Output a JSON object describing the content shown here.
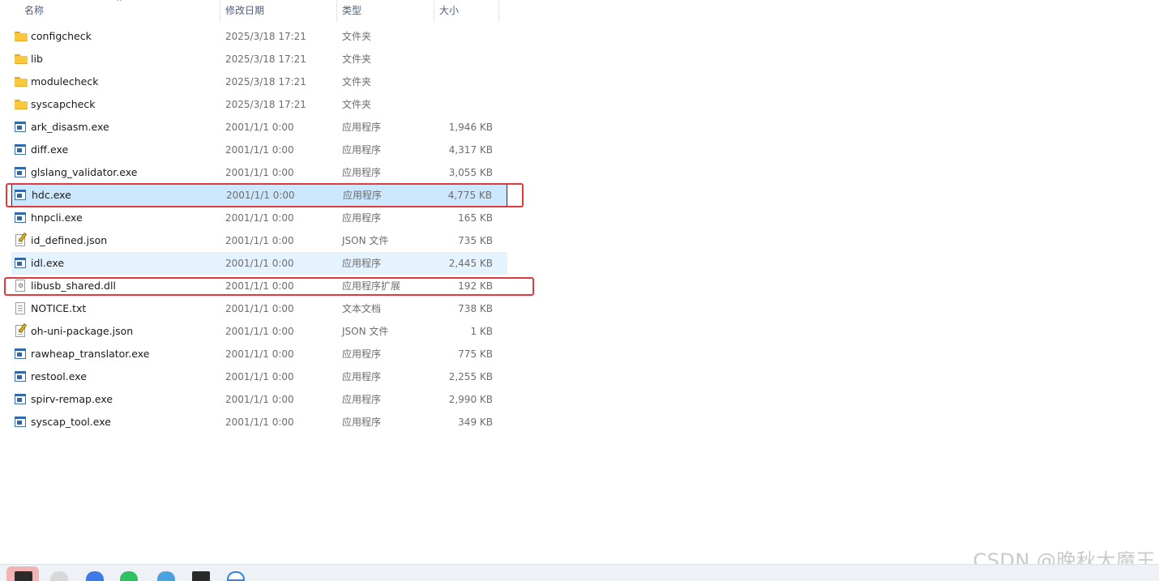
{
  "columns": {
    "name": "名称",
    "date": "修改日期",
    "type": "类型",
    "size": "大小"
  },
  "sort_indicator": "^",
  "files": [
    {
      "name": "configcheck",
      "date": "2025/3/18 17:21",
      "type": "文件夹",
      "size": "",
      "icon": "folder-icon"
    },
    {
      "name": "lib",
      "date": "2025/3/18 17:21",
      "type": "文件夹",
      "size": "",
      "icon": "folder-icon"
    },
    {
      "name": "modulecheck",
      "date": "2025/3/18 17:21",
      "type": "文件夹",
      "size": "",
      "icon": "folder-icon"
    },
    {
      "name": "syscapcheck",
      "date": "2025/3/18 17:21",
      "type": "文件夹",
      "size": "",
      "icon": "folder-icon"
    },
    {
      "name": "ark_disasm.exe",
      "date": "2001/1/1 0:00",
      "type": "应用程序",
      "size": "1,946 KB",
      "icon": "exe-icon"
    },
    {
      "name": "diff.exe",
      "date": "2001/1/1 0:00",
      "type": "应用程序",
      "size": "4,317 KB",
      "icon": "exe-icon"
    },
    {
      "name": "glslang_validator.exe",
      "date": "2001/1/1 0:00",
      "type": "应用程序",
      "size": "3,055 KB",
      "icon": "exe-icon"
    },
    {
      "name": "hdc.exe",
      "date": "2001/1/1 0:00",
      "type": "应用程序",
      "size": "4,775 KB",
      "icon": "exe-icon"
    },
    {
      "name": "hnpcli.exe",
      "date": "2001/1/1 0:00",
      "type": "应用程序",
      "size": "165 KB",
      "icon": "exe-icon"
    },
    {
      "name": "id_defined.json",
      "date": "2001/1/1 0:00",
      "type": "JSON 文件",
      "size": "735 KB",
      "icon": "json-file-icon"
    },
    {
      "name": "idl.exe",
      "date": "2001/1/1 0:00",
      "type": "应用程序",
      "size": "2,445 KB",
      "icon": "exe-icon"
    },
    {
      "name": "libusb_shared.dll",
      "date": "2001/1/1 0:00",
      "type": "应用程序扩展",
      "size": "192 KB",
      "icon": "dll-file-icon"
    },
    {
      "name": "NOTICE.txt",
      "date": "2001/1/1 0:00",
      "type": "文本文档",
      "size": "738 KB",
      "icon": "text-file-icon"
    },
    {
      "name": "oh-uni-package.json",
      "date": "2001/1/1 0:00",
      "type": "JSON 文件",
      "size": "1 KB",
      "icon": "json-file-icon"
    },
    {
      "name": "rawheap_translator.exe",
      "date": "2001/1/1 0:00",
      "type": "应用程序",
      "size": "775 KB",
      "icon": "exe-icon"
    },
    {
      "name": "restool.exe",
      "date": "2001/1/1 0:00",
      "type": "应用程序",
      "size": "2,255 KB",
      "icon": "exe-icon"
    },
    {
      "name": "spirv-remap.exe",
      "date": "2001/1/1 0:00",
      "type": "应用程序",
      "size": "2,990 KB",
      "icon": "exe-icon"
    },
    {
      "name": "syscap_tool.exe",
      "date": "2001/1/1 0:00",
      "type": "应用程序",
      "size": "349 KB",
      "icon": "exe-icon"
    }
  ],
  "selected_row": "hdc.exe",
  "hover_row": "idl.exe",
  "highlighted_rows": [
    "hdc.exe",
    "libusb_shared.dll"
  ],
  "highlight_color": "#e0393e",
  "selection_color": "#cce8ff",
  "watermark": "CSDN @晚秋大魔王"
}
